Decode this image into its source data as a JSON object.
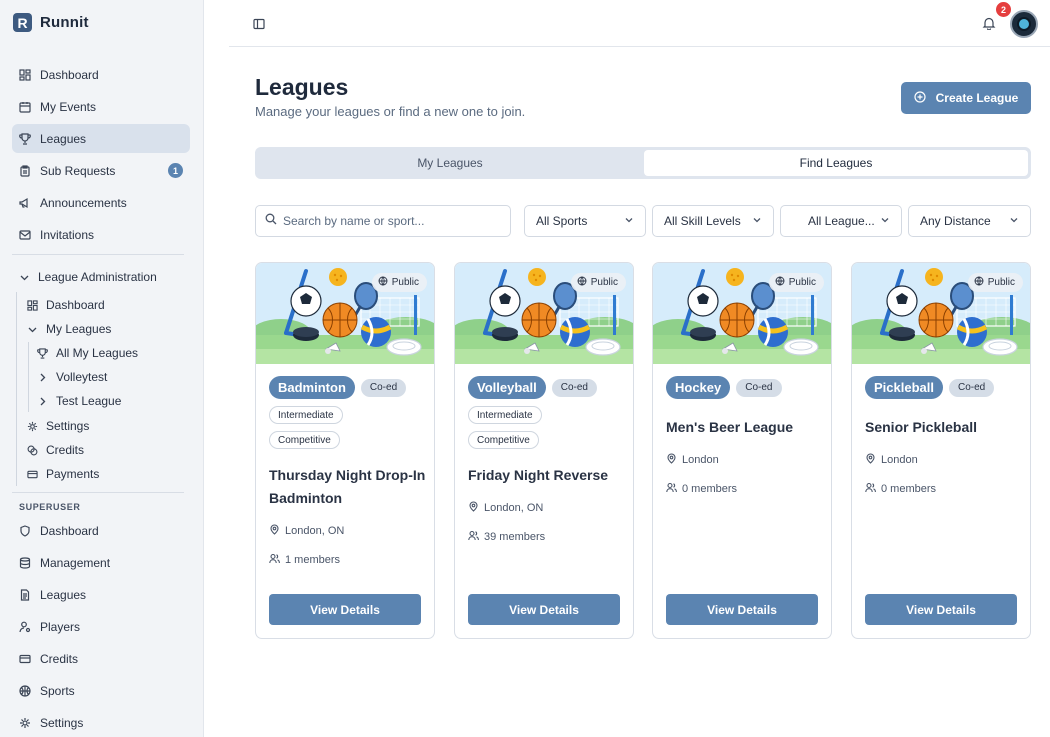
{
  "app": {
    "name": "Runnit",
    "logo_letter": "R"
  },
  "sidebar": {
    "main": [
      {
        "label": "Dashboard",
        "icon": "grid-icon"
      },
      {
        "label": "My Events",
        "icon": "calendar-icon"
      },
      {
        "label": "Leagues",
        "icon": "trophy-icon",
        "active": true
      },
      {
        "label": "Sub Requests",
        "icon": "clipboard-icon",
        "badge": "1"
      },
      {
        "label": "Announcements",
        "icon": "megaphone-icon"
      },
      {
        "label": "Invitations",
        "icon": "mail-icon"
      }
    ],
    "league_admin": {
      "label": "League Administration",
      "items": {
        "dashboard": "Dashboard",
        "my_leagues": "My Leagues",
        "all_my_leagues": "All My Leagues",
        "volleytest": "Volleytest",
        "test_league": "Test League",
        "settings": "Settings",
        "credits": "Credits",
        "payments": "Payments"
      }
    },
    "superuser": {
      "label": "SUPERUSER",
      "items": [
        {
          "label": "Dashboard",
          "icon": "shield-icon"
        },
        {
          "label": "Management",
          "icon": "database-icon"
        },
        {
          "label": "Leagues",
          "icon": "document-icon"
        },
        {
          "label": "Players",
          "icon": "user-cog-icon"
        },
        {
          "label": "Credits",
          "icon": "wallet-icon"
        },
        {
          "label": "Sports",
          "icon": "basketball-icon"
        },
        {
          "label": "Settings",
          "icon": "gear-icon"
        }
      ]
    }
  },
  "topbar": {
    "notifications": "2"
  },
  "header": {
    "title": "Leagues",
    "subtitle": "Manage your leagues or find a new one to join.",
    "create_label": "Create League"
  },
  "tabs": {
    "my_leagues": "My Leagues",
    "find_leagues": "Find Leagues",
    "active": "find_leagues"
  },
  "filters": {
    "search_placeholder": "Search by name or sport...",
    "sports": "All Sports",
    "skill": "All Skill Levels",
    "league_type": "All League...",
    "distance": "Any Distance"
  },
  "cards": [
    {
      "sport": "Badminton",
      "gender": "Co-ed",
      "levels": [
        "Intermediate",
        "Competitive"
      ],
      "title": "Thursday Night Drop-In Badminton",
      "location": "London, ON",
      "members": "1 members",
      "visibility": "Public",
      "cta": "View Details"
    },
    {
      "sport": "Volleyball",
      "gender": "Co-ed",
      "levels": [
        "Intermediate",
        "Competitive"
      ],
      "title": "Friday Night Reverse",
      "location": "London, ON",
      "members": "39 members",
      "visibility": "Public",
      "cta": "View Details"
    },
    {
      "sport": "Hockey",
      "gender": "Co-ed",
      "levels": [],
      "title": "Men's Beer League",
      "location": "London",
      "members": "0 members",
      "visibility": "Public",
      "cta": "View Details"
    },
    {
      "sport": "Pickleball",
      "gender": "Co-ed",
      "levels": [],
      "title": "Senior Pickleball",
      "location": "London",
      "members": "0 members",
      "visibility": "Public",
      "cta": "View Details"
    }
  ],
  "colors": {
    "accent": "#5b84b1",
    "sidebar_bg": "#f2f4f7",
    "active_bg": "#d9e1ec",
    "notification": "#e53e3e"
  }
}
